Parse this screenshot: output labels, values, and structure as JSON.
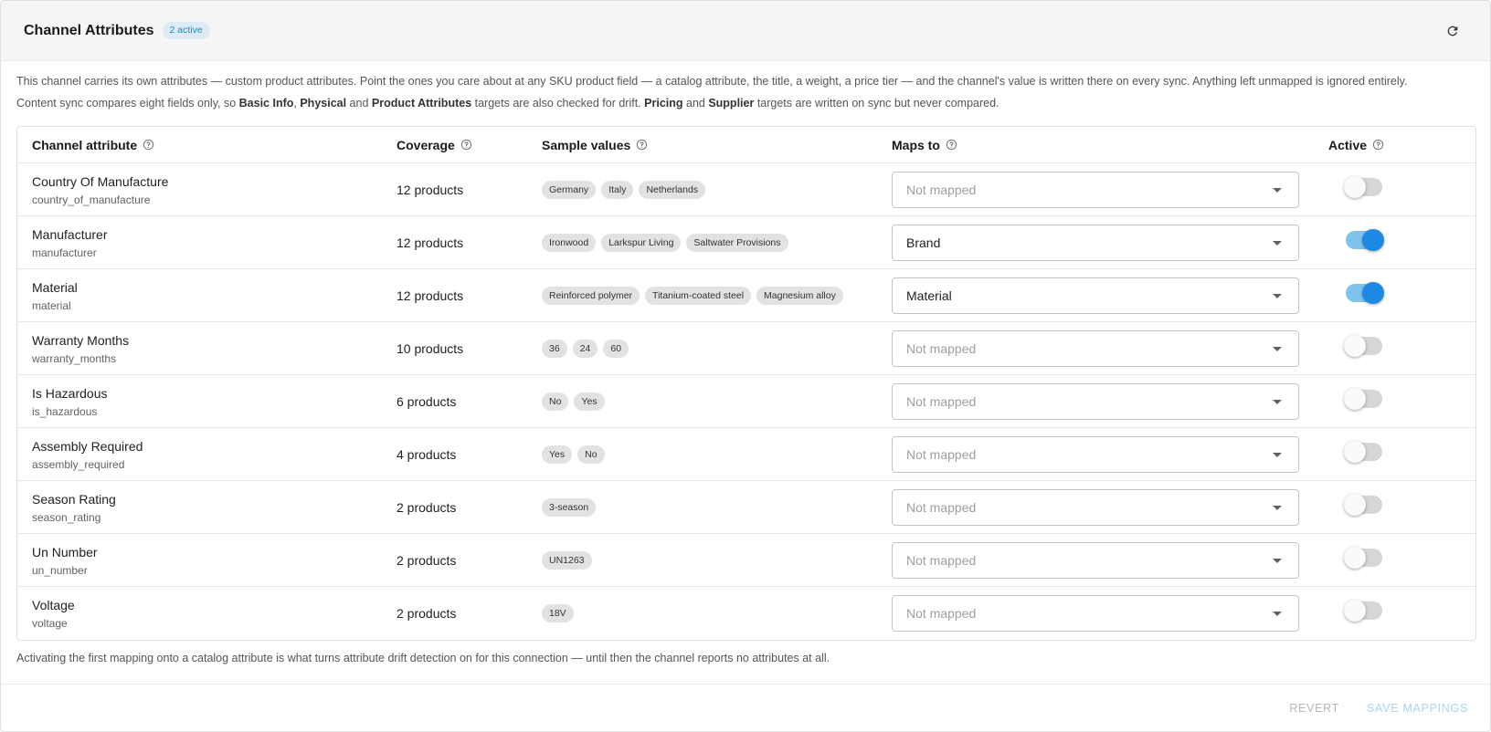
{
  "header": {
    "title": "Channel Attributes",
    "badge": "2 active"
  },
  "description": {
    "line1": "This channel carries its own attributes — custom product attributes. Point the ones you care about at any SKU product field — a catalog attribute, the title, a weight, a price tier — and the channel's value is written there on every sync. Anything left unmapped is ignored entirely.",
    "line2_parts": [
      "Content sync compares eight fields only, so ",
      "Basic Info",
      ", ",
      "Physical",
      " and ",
      "Product Attributes",
      " targets are also checked for drift. ",
      "Pricing",
      " and ",
      "Supplier",
      " targets are written on sync but never compared."
    ]
  },
  "table": {
    "columns": [
      "Channel attribute",
      "Coverage",
      "Sample values",
      "Maps to",
      "Active"
    ],
    "rows": [
      {
        "name": "Country Of Manufacture",
        "key": "country_of_manufacture",
        "coverage": "12 products",
        "samples": [
          "Germany",
          "Italy",
          "Netherlands"
        ],
        "maps_to": "Not mapped",
        "mapped": false,
        "active": false
      },
      {
        "name": "Manufacturer",
        "key": "manufacturer",
        "coverage": "12 products",
        "samples": [
          "Ironwood",
          "Larkspur Living",
          "Saltwater Provisions"
        ],
        "maps_to": "Brand",
        "mapped": true,
        "active": true
      },
      {
        "name": "Material",
        "key": "material",
        "coverage": "12 products",
        "samples": [
          "Reinforced polymer",
          "Titanium-coated steel",
          "Magnesium alloy"
        ],
        "maps_to": "Material",
        "mapped": true,
        "active": true
      },
      {
        "name": "Warranty Months",
        "key": "warranty_months",
        "coverage": "10 products",
        "samples": [
          "36",
          "24",
          "60"
        ],
        "maps_to": "Not mapped",
        "mapped": false,
        "active": false
      },
      {
        "name": "Is Hazardous",
        "key": "is_hazardous",
        "coverage": "6 products",
        "samples": [
          "No",
          "Yes"
        ],
        "maps_to": "Not mapped",
        "mapped": false,
        "active": false
      },
      {
        "name": "Assembly Required",
        "key": "assembly_required",
        "coverage": "4 products",
        "samples": [
          "Yes",
          "No"
        ],
        "maps_to": "Not mapped",
        "mapped": false,
        "active": false
      },
      {
        "name": "Season Rating",
        "key": "season_rating",
        "coverage": "2 products",
        "samples": [
          "3-season"
        ],
        "maps_to": "Not mapped",
        "mapped": false,
        "active": false
      },
      {
        "name": "Un Number",
        "key": "un_number",
        "coverage": "2 products",
        "samples": [
          "UN1263"
        ],
        "maps_to": "Not mapped",
        "mapped": false,
        "active": false
      },
      {
        "name": "Voltage",
        "key": "voltage",
        "coverage": "2 products",
        "samples": [
          "18V"
        ],
        "maps_to": "Not mapped",
        "mapped": false,
        "active": false
      }
    ]
  },
  "footnote": "Activating the first mapping onto a catalog attribute is what turns attribute drift detection on for this connection — until then the channel reports no attributes at all.",
  "actions": {
    "revert": "REVERT",
    "save": "SAVE MAPPINGS"
  },
  "colors": {
    "accent": "#1e88e5",
    "badge_bg": "#dcebf5",
    "switch_track_on": "#7ec4ef"
  },
  "icons": {
    "refresh": "refresh-icon",
    "help": "help-circle-icon",
    "caret": "caret-down-icon"
  }
}
